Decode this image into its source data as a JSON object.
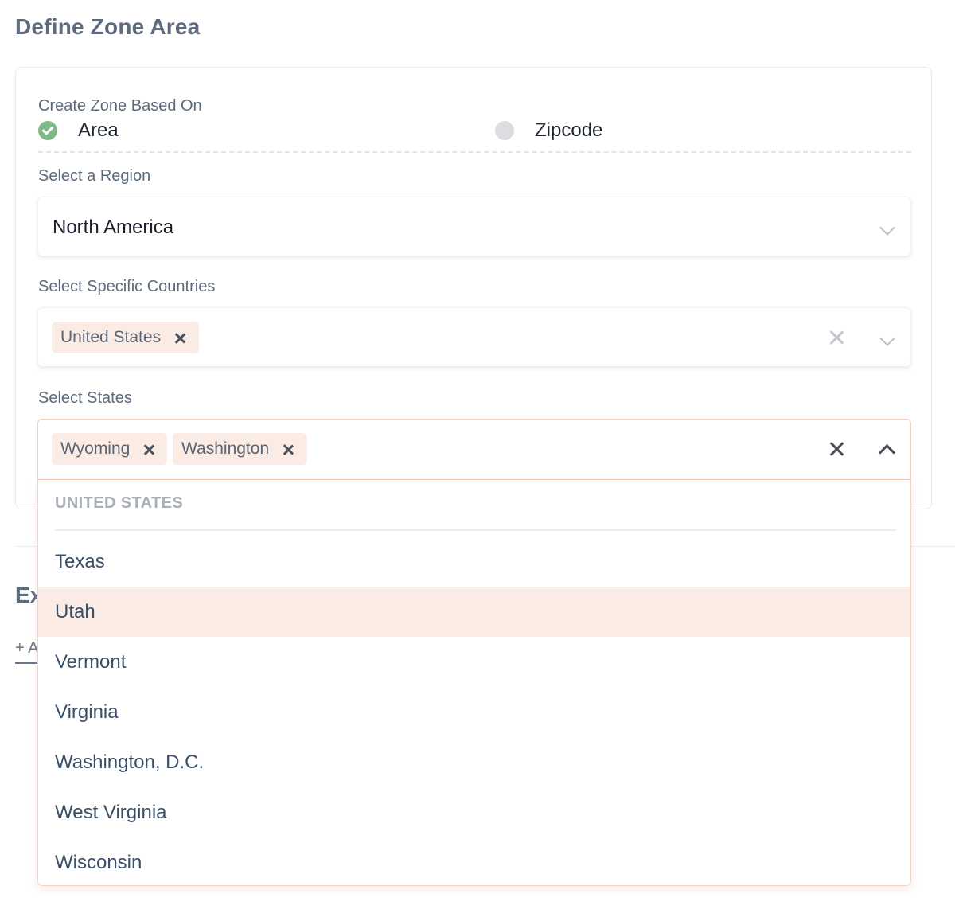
{
  "page_title": "Define Zone Area",
  "zone_basis": {
    "label": "Create Zone Based On",
    "options": [
      {
        "label": "Area",
        "selected": true
      },
      {
        "label": "Zipcode",
        "selected": false
      }
    ]
  },
  "region": {
    "label": "Select a Region",
    "value": "North America"
  },
  "countries": {
    "label": "Select Specific Countries",
    "tags": [
      "United States"
    ]
  },
  "states": {
    "label": "Select States",
    "tags": [
      "Wyoming",
      "Washington"
    ],
    "dropdown": {
      "group_header": "UNITED STATES",
      "options": [
        "Texas",
        "Utah",
        "Vermont",
        "Virginia",
        "Washington, D.C.",
        "West Virginia",
        "Wisconsin"
      ],
      "highlighted_index": 1
    }
  },
  "behind_section": {
    "heading": "Ex",
    "link": "+ A"
  },
  "colors": {
    "accent_check": "#7fba86",
    "tag_bg": "#faece5",
    "highlight_bg": "#faece5"
  }
}
